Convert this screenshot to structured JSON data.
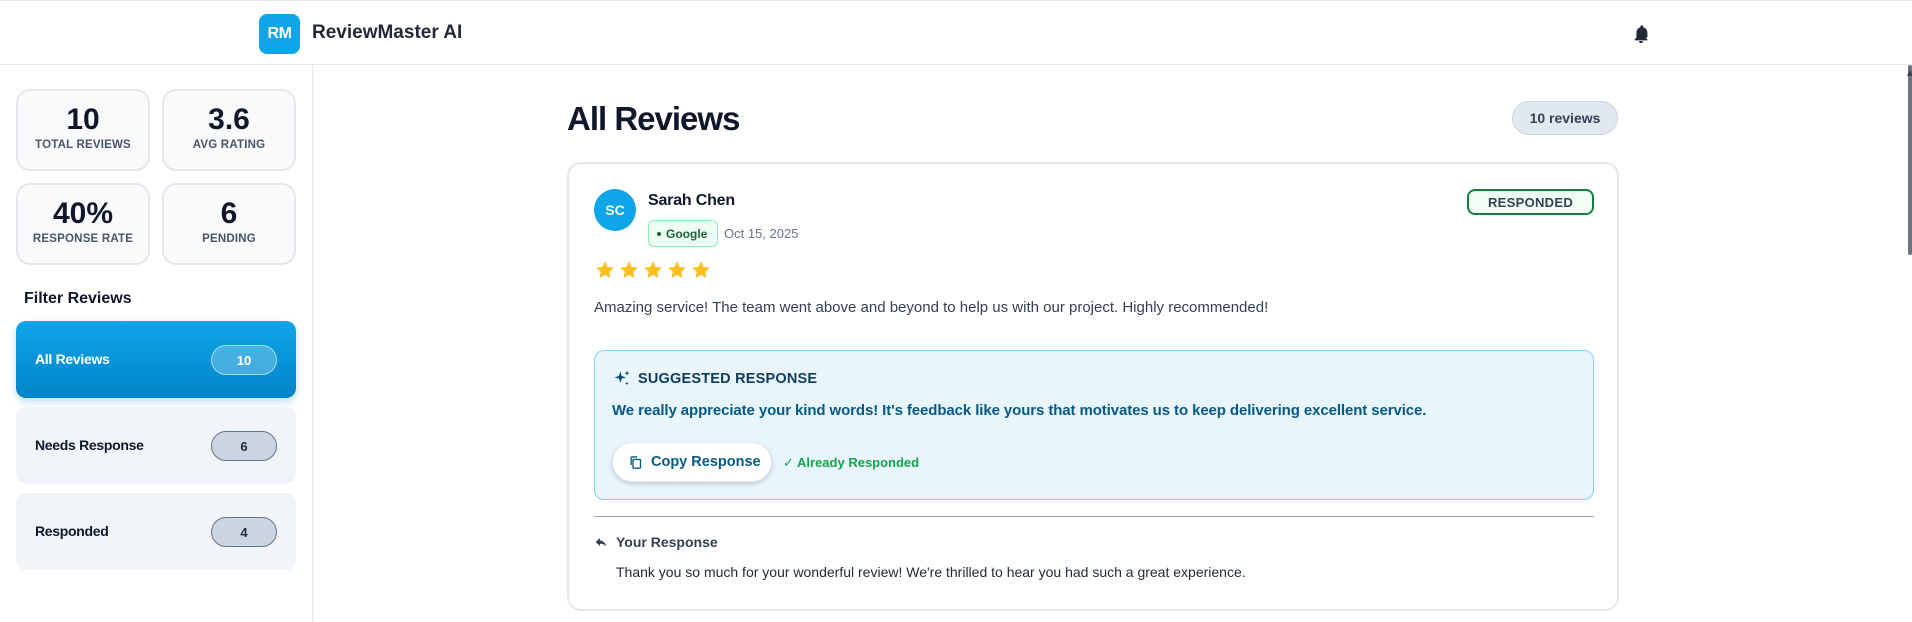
{
  "header": {
    "logo_initials": "RM",
    "app_name": "ReviewMaster AI",
    "icons": {
      "notifications": "bell-icon"
    }
  },
  "stats": [
    {
      "value": "10",
      "label": "TOTAL REVIEWS"
    },
    {
      "value": "3.6",
      "label": "AVG RATING"
    },
    {
      "value": "40%",
      "label": "RESPONSE RATE"
    },
    {
      "value": "6",
      "label": "PENDING"
    }
  ],
  "filters": {
    "heading": "Filter Reviews",
    "items": [
      {
        "label": "All Reviews",
        "count": "10",
        "active": true
      },
      {
        "label": "Needs Response",
        "count": "6",
        "active": false
      },
      {
        "label": "Responded",
        "count": "4",
        "active": false
      }
    ]
  },
  "main": {
    "title": "All Reviews",
    "review_count_label": "10 reviews"
  },
  "review": {
    "avatar_initials": "SC",
    "name": "Sarah Chen",
    "source": "Google",
    "date": "Oct 15, 2025",
    "status": "RESPONDED",
    "rating": 5,
    "rating_max": 5,
    "text": "Amazing service! The team went above and beyond to help us with our project. Highly recommended!",
    "suggested": {
      "title": "SUGGESTED RESPONSE",
      "text": "We really appreciate your kind words! It's feedback like yours that motivates us to keep delivering excellent service.",
      "copy_label": "Copy Response",
      "responded_note": "✓ Already Responded"
    },
    "your_response": {
      "title": "Your Response",
      "text": "Thank you so much for your wonderful review! We're thrilled to hear you had such a great experience."
    }
  },
  "colors": {
    "accent": "#0ea5e9",
    "accent_dark": "#0284c7",
    "star": "#fbbf24",
    "success": "#16a34a",
    "suggest_bg": "#e8f5fd"
  }
}
